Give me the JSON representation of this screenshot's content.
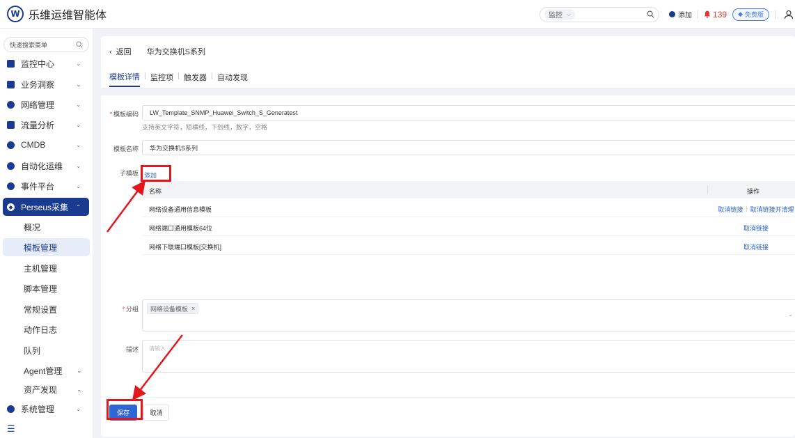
{
  "header": {
    "logo_letter": "W",
    "app_title": "乐维运维智能体",
    "search_scope": "监控",
    "add_label": "添加",
    "alarm_count": "139",
    "free_badge": "免费版",
    "brand_color": "#1a3a8f"
  },
  "sidebar": {
    "search_placeholder": "快速搜索菜单",
    "items": [
      {
        "label": "监控中心",
        "icon": "monitor-icon"
      },
      {
        "label": "业务洞察",
        "icon": "insight-icon"
      },
      {
        "label": "网络管理",
        "icon": "globe-icon"
      },
      {
        "label": "流量分析",
        "icon": "traffic-chart-icon"
      },
      {
        "label": "CMDB",
        "icon": "database-cube-icon"
      },
      {
        "label": "自动化运维",
        "icon": "gear-icon"
      },
      {
        "label": "事件平台",
        "icon": "bell-icon"
      },
      {
        "label": "Perseus采集",
        "icon": "perseus-icon"
      }
    ],
    "sub_items": [
      {
        "label": "概况"
      },
      {
        "label": "模板管理"
      },
      {
        "label": "主机管理"
      },
      {
        "label": "脚本管理"
      },
      {
        "label": "常规设置"
      },
      {
        "label": "动作日志"
      },
      {
        "label": "队列"
      },
      {
        "label": "Agent管理"
      },
      {
        "label": "资产发现"
      }
    ],
    "system": {
      "label": "系统管理",
      "icon": "settings-icon"
    }
  },
  "page": {
    "back_label": "返回",
    "title": "华为交换机S系列",
    "tabs": [
      {
        "label": "模板详情"
      },
      {
        "label": "监控项"
      },
      {
        "label": "触发器"
      },
      {
        "label": "自动发现"
      }
    ]
  },
  "form": {
    "code_label": "模板编码",
    "code_value": "LW_Template_SNMP_Huawei_Switch_S_Generatest",
    "code_hint": "支持英文字符，短横线，下划线，数字，空格",
    "name_label": "模板名称",
    "name_value": "华为交换机S系列",
    "sub_label": "子模板",
    "sub_add": "添加",
    "table": {
      "headers": [
        "名称",
        "操作"
      ],
      "rows": [
        {
          "name": "网络设备通用信息模板",
          "actions": [
            "取消链接",
            "取消链接并清理"
          ]
        },
        {
          "name": "网络端口通用模板64位",
          "actions": [
            "取消链接"
          ]
        },
        {
          "name": "网络下联端口模板[交换机]",
          "actions": [
            "取消链接"
          ]
        }
      ]
    },
    "group_label": "分组",
    "group_tag": "网络设备模板",
    "desc_label": "描述",
    "desc_placeholder": "请输入",
    "save_label": "保存",
    "cancel_label": "取消"
  }
}
